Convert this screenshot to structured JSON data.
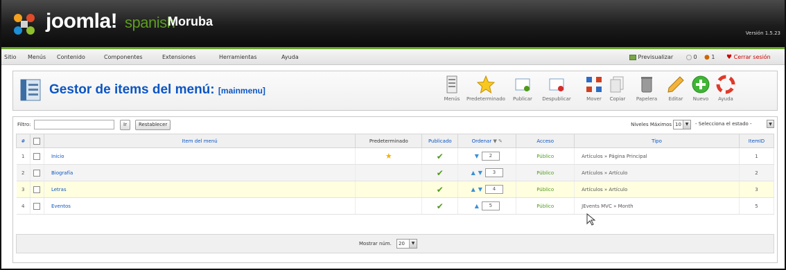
{
  "header": {
    "brand": "joomla!",
    "brand_sub": "spanish",
    "site_name": "Moruba",
    "version": "Versión 1.5.23"
  },
  "menubar": {
    "items": [
      "Sitio",
      "Menús",
      "Contenido",
      "Componentes",
      "Extensiones",
      "Herramientas",
      "Ayuda"
    ],
    "right": {
      "preview": "Previsualizar",
      "visitors": "0",
      "admins": "1",
      "logout": "Cerrar sesión"
    }
  },
  "page": {
    "title": "Gestor de items del menú:",
    "subtitle": "[mainmenu]"
  },
  "toolbar": {
    "buttons": [
      {
        "label": "Menús",
        "icon": "menus-icon"
      },
      {
        "label": "Predeterminado",
        "icon": "star-icon"
      },
      {
        "label": "Publicar",
        "icon": "publish-icon"
      },
      {
        "label": "Despublicar",
        "icon": "unpublish-icon"
      },
      {
        "label": "Mover",
        "icon": "move-icon"
      },
      {
        "label": "Copiar",
        "icon": "copy-icon"
      },
      {
        "label": "Papelera",
        "icon": "trash-icon"
      },
      {
        "label": "Editar",
        "icon": "edit-icon"
      },
      {
        "label": "Nuevo",
        "icon": "new-icon"
      },
      {
        "label": "Ayuda",
        "icon": "help-icon"
      }
    ]
  },
  "filter": {
    "label": "Filtro:",
    "value": "",
    "go_button": "Ir",
    "reset_button": "Restablecer",
    "levels_label": "Niveles Máximos",
    "levels_value": "10",
    "state_value": "- Selecciona el estado -"
  },
  "table": {
    "headers": {
      "num": "#",
      "item": "Item del menú",
      "default": "Predeterminado",
      "published": "Publicado",
      "order": "Ordenar",
      "access": "Acceso",
      "type": "Tipo",
      "itemid": "ItemID"
    },
    "rows": [
      {
        "num": "1",
        "name": "Inicio",
        "default": true,
        "published": true,
        "order": "2",
        "access": "Público",
        "type": "Artículos » Página Principal",
        "itemid": "1"
      },
      {
        "num": "2",
        "name": "Biografía",
        "default": false,
        "published": true,
        "order": "3",
        "access": "Público",
        "type": "Artículos » Artículo",
        "itemid": "2"
      },
      {
        "num": "3",
        "name": "Letras",
        "default": false,
        "published": true,
        "order": "4",
        "access": "Público",
        "type": "Artículos » Artículo",
        "itemid": "3"
      },
      {
        "num": "4",
        "name": "Eventos",
        "default": false,
        "published": true,
        "order": "5",
        "access": "Público",
        "type": "JEvents MVC » Month",
        "itemid": "5"
      }
    ]
  },
  "footer": {
    "show_label": "Mostrar núm.",
    "show_value": "20"
  },
  "colors": {
    "accent_green": "#6aa62c",
    "link_blue": "#0b55c4",
    "highlight_row": "#ffffe0"
  }
}
